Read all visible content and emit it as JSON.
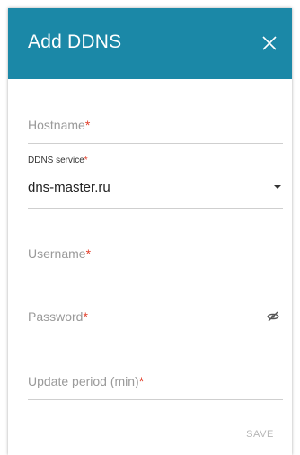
{
  "dialog": {
    "title": "Add DDNS",
    "close_icon": "close-icon",
    "header_color": "#1b88a7"
  },
  "fields": {
    "hostname": {
      "placeholder": "Hostname",
      "required_mark": "*"
    },
    "ddns_service": {
      "label": "DDNS service",
      "required_mark": "*",
      "value": "dns-master.ru",
      "icon": "caret-down-icon"
    },
    "username": {
      "placeholder": "Username",
      "required_mark": "*"
    },
    "password": {
      "placeholder": "Password",
      "required_mark": "*",
      "icon": "eye-off-icon"
    },
    "update_period": {
      "placeholder": "Update period (min)",
      "required_mark": "*"
    }
  },
  "actions": {
    "save_label": "SAVE"
  }
}
